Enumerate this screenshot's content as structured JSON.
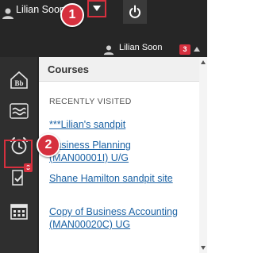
{
  "top_bar": {
    "username": "Lilian Soon",
    "dropdown_icon": "caret-down-icon",
    "power_icon": "power-icon"
  },
  "callouts": {
    "step1": "1",
    "step2": "2"
  },
  "header": {
    "username": "Lilian Soon",
    "notification_count": "3",
    "menu_icon": "caret-up-icon"
  },
  "nav": {
    "items": [
      {
        "icon": "bb-home-icon"
      },
      {
        "icon": "stream-wave-icon"
      },
      {
        "icon": "alarm-clock-icon"
      },
      {
        "icon": "grades-check-icon",
        "badge": "3"
      },
      {
        "icon": "calendar-icon"
      }
    ]
  },
  "courses": {
    "title": "Courses",
    "recent_heading": "RECENTLY VISITED",
    "items": [
      {
        "label": "***Lilian's sandpit"
      },
      {
        "label": "Business Planning (MAN00001I) U/G"
      },
      {
        "label": "Shane Hamilton sandpit site"
      },
      {
        "label": "Copy of Business Accounting (MAN00020C) UG"
      }
    ]
  },
  "colors": {
    "dark_bar": "#262626",
    "nav_bg": "#2f2f2f",
    "accent_red": "#d6303e",
    "link_blue": "#1b62a4"
  }
}
